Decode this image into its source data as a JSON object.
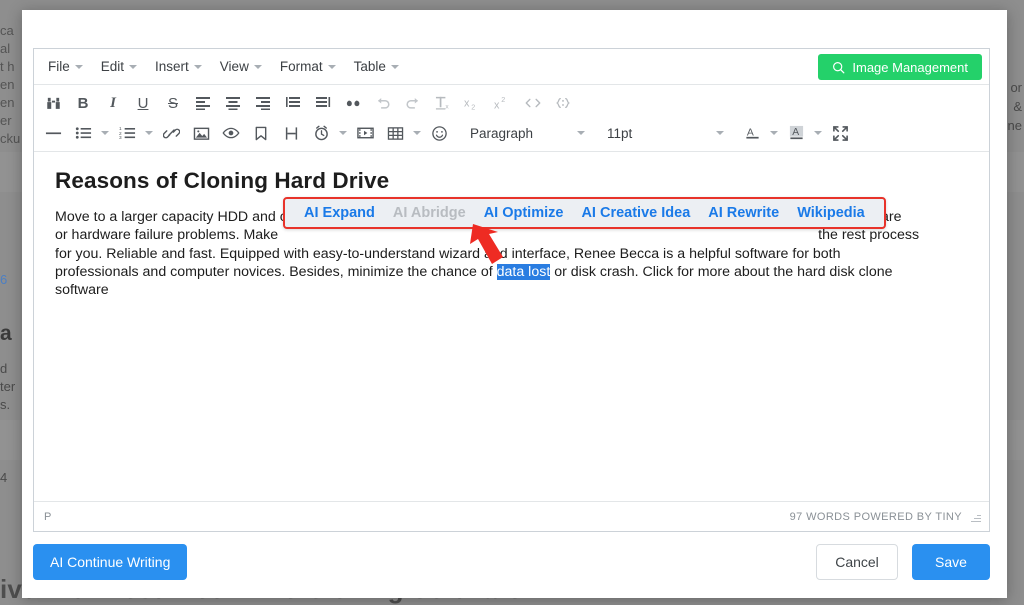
{
  "background": {
    "left_fragments": [
      "ca",
      "al",
      "t h",
      "en",
      "en",
      "er",
      "cku"
    ],
    "blue_fragment": "6",
    "heading_fragment": "a",
    "small_fragments": [
      "d",
      "ter",
      "s."
    ],
    "number_fragment": "4",
    "right_fragments": [
      "or",
      "&",
      "ne"
    ],
    "bottom_heading": "ive with Best Free Drive Cloning Software"
  },
  "editor": {
    "menubar": [
      {
        "label": "File",
        "name": "menu-file"
      },
      {
        "label": "Edit",
        "name": "menu-edit"
      },
      {
        "label": "Insert",
        "name": "menu-insert"
      },
      {
        "label": "View",
        "name": "menu-view"
      },
      {
        "label": "Format",
        "name": "menu-format"
      },
      {
        "label": "Table",
        "name": "menu-table"
      }
    ],
    "image_management_button": {
      "label": "Image Management",
      "icon": "search-icon",
      "color": "#24d16a"
    },
    "toolbar_row1": [
      "searchreplace-binoculars-icon",
      "bold-icon",
      "italic-icon",
      "underline-icon",
      "strikethrough-icon",
      "align-left-icon",
      "align-center-icon",
      "align-right-icon",
      "align-justify-icon",
      "indent-icon",
      "blockquote-icon",
      "undo-icon",
      "redo-icon",
      "remove-format-icon",
      "subscript-icon",
      "superscript-icon",
      "source-code-icon",
      "code-sample-icon"
    ],
    "toolbar_row2": [
      "horizontal-rule-icon",
      "bullet-list-icon",
      "numbered-list-icon",
      "link-icon",
      "image-icon",
      "preview-icon",
      "anchor-icon",
      "page-break-icon",
      "insert-datetime-icon",
      "media-icon",
      "table-icon",
      "emoticon-icon"
    ],
    "block_format": "Paragraph",
    "font_size": "11pt",
    "color_controls": [
      "text-color-icon",
      "background-color-icon",
      "fullscreen-icon"
    ],
    "document": {
      "title": "Reasons of Cloning Hard Drive",
      "paragraph_part1": "Move to a larger capacity HDD and c",
      "paragraph_part2": "or hardware failure problems. Make",
      "paragraph_hidden_tail1": "possible software",
      "paragraph_hidden_tail2": "the rest process",
      "paragraph_line3": "for you. Reliable and fast. Equipped with easy-to-understand wizard and interface, Renee Becca is a helpful software for both",
      "paragraph_line4_a": "professionals and computer novices. Besides, minimize the chance of ",
      "paragraph_line4_selected": "data lost",
      "paragraph_line4_b": " or disk crash. Click for more about the hard disk clone",
      "paragraph_line5": "software"
    },
    "ai_toolbar": {
      "border_color": "#e8332a",
      "items": [
        {
          "label": "AI Expand",
          "disabled": false
        },
        {
          "label": "AI Abridge",
          "disabled": true
        },
        {
          "label": "AI Optimize",
          "disabled": false
        },
        {
          "label": "AI Creative Idea",
          "disabled": false
        },
        {
          "label": "AI Rewrite",
          "disabled": false
        },
        {
          "label": "Wikipedia",
          "disabled": false
        }
      ]
    },
    "statusbar": {
      "path": "P",
      "info": "97 WORDS POWERED BY TINY"
    }
  },
  "footer": {
    "ai_continue_label": "AI Continue Writing",
    "cancel_label": "Cancel",
    "save_label": "Save",
    "primary_color": "#2a90f0"
  }
}
